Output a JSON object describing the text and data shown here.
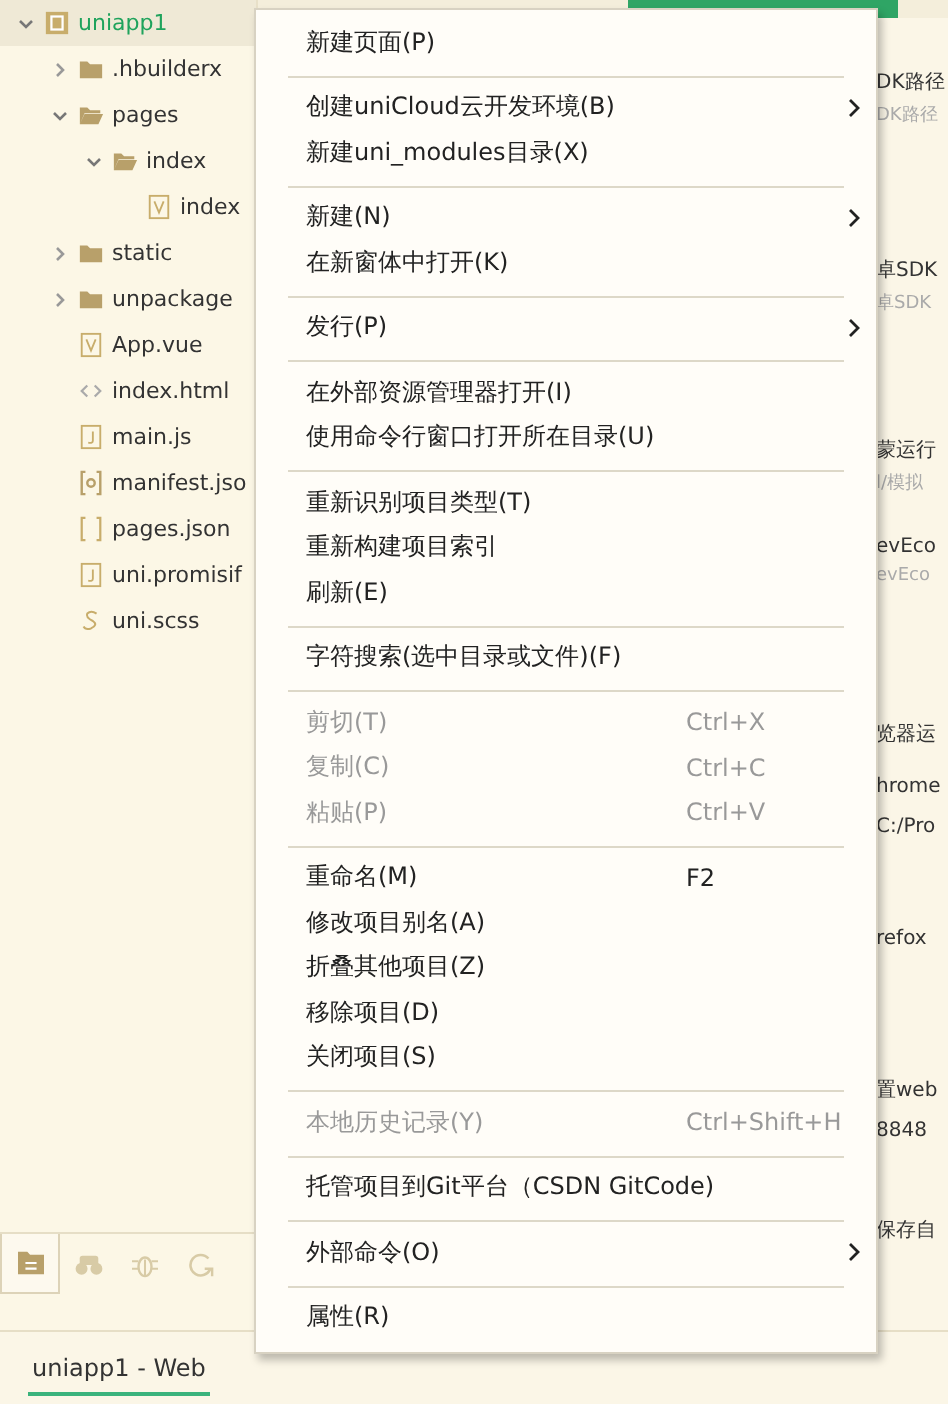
{
  "tree": [
    {
      "name": "uniapp1",
      "kind": "project",
      "expanded": true,
      "selected": true,
      "children": [
        {
          "name": ".hbuilderx",
          "kind": "folder",
          "expanded": false,
          "selected": false
        },
        {
          "name": "pages",
          "kind": "folder",
          "expanded": true,
          "selected": false,
          "children": [
            {
              "name": "index",
              "kind": "folder",
              "expanded": true,
              "selected": false,
              "children": [
                {
                  "name": "index",
                  "kind": "vue",
                  "selected": false
                }
              ]
            }
          ]
        },
        {
          "name": "static",
          "kind": "folder",
          "expanded": false,
          "selected": false
        },
        {
          "name": "unpackage",
          "kind": "folder",
          "expanded": false,
          "selected": false
        },
        {
          "name": "App.vue",
          "kind": "vue",
          "selected": false
        },
        {
          "name": "index.html",
          "kind": "html",
          "selected": false
        },
        {
          "name": "main.js",
          "kind": "js",
          "selected": false
        },
        {
          "name": "manifest.jso",
          "kind": "manifest",
          "selected": false
        },
        {
          "name": "pages.json",
          "kind": "json",
          "selected": false
        },
        {
          "name": "uni.promisif",
          "kind": "js",
          "selected": false
        },
        {
          "name": "uni.scss",
          "kind": "scss",
          "selected": false
        }
      ]
    }
  ],
  "sidebar_tabs": [
    {
      "selected": true
    },
    {
      "selected": false
    },
    {
      "selected": false
    },
    {
      "selected": false
    }
  ],
  "status_bar": {
    "label": "uniapp1 - Web"
  },
  "settings_fragments": [
    {
      "text": "DK路径",
      "muted": false
    },
    {
      "text": "DK路径",
      "muted": true
    },
    {
      "text": "卓SDK",
      "muted": false
    },
    {
      "text": "卓SDK",
      "muted": true
    },
    {
      "text": "蒙运行",
      "muted": false
    },
    {
      "text": "l/模拟",
      "muted": true
    },
    {
      "text": "evEco",
      "muted": false
    },
    {
      "text": "evEco",
      "muted": true
    },
    {
      "text": "览器运",
      "muted": false
    },
    {
      "text": "hrome",
      "muted": false
    },
    {
      "text": "C:/Pro",
      "muted": false
    },
    {
      "text": "refox",
      "muted": false
    },
    {
      "text": "置web",
      "muted": false
    },
    {
      "text": "8848",
      "muted": false
    },
    {
      "text": "保存自",
      "muted": false
    }
  ],
  "context_menu": [
    [
      {
        "label": "新建页面(P)",
        "disabled": false,
        "submenu": false
      }
    ],
    [
      {
        "label": "创建uniCloud云开发环境(B)",
        "disabled": false,
        "submenu": true
      },
      {
        "label": "新建uni_modules目录(X)",
        "disabled": false,
        "submenu": false
      }
    ],
    [
      {
        "label": "新建(N)",
        "disabled": false,
        "submenu": true
      },
      {
        "label": "在新窗体中打开(K)",
        "disabled": false,
        "submenu": false
      }
    ],
    [
      {
        "label": "发行(P)",
        "disabled": false,
        "submenu": true
      }
    ],
    [
      {
        "label": "在外部资源管理器打开(I)",
        "disabled": false,
        "submenu": false
      },
      {
        "label": "使用命令行窗口打开所在目录(U)",
        "disabled": false,
        "submenu": false
      }
    ],
    [
      {
        "label": "重新识别项目类型(T)",
        "disabled": false,
        "submenu": false
      },
      {
        "label": "重新构建项目索引",
        "disabled": false,
        "submenu": false
      },
      {
        "label": "刷新(E)",
        "disabled": false,
        "submenu": false
      }
    ],
    [
      {
        "label": "字符搜索(选中目录或文件)(F)",
        "disabled": false,
        "submenu": false
      }
    ],
    [
      {
        "label": "剪切(T)",
        "shortcut": "Ctrl+X",
        "disabled": true,
        "submenu": false
      },
      {
        "label": "复制(C)",
        "shortcut": "Ctrl+C",
        "disabled": true,
        "submenu": false
      },
      {
        "label": "粘贴(P)",
        "shortcut": "Ctrl+V",
        "disabled": true,
        "submenu": false
      }
    ],
    [
      {
        "label": "重命名(M)",
        "shortcut": "F2",
        "disabled": false,
        "submenu": false
      },
      {
        "label": "修改项目别名(A)",
        "disabled": false,
        "submenu": false
      },
      {
        "label": "折叠其他项目(Z)",
        "disabled": false,
        "submenu": false
      },
      {
        "label": "移除项目(D)",
        "disabled": false,
        "submenu": false
      },
      {
        "label": "关闭项目(S)",
        "disabled": false,
        "submenu": false
      }
    ],
    [
      {
        "label": "本地历史记录(Y)",
        "shortcut": "Ctrl+Shift+H",
        "disabled": true,
        "submenu": false
      }
    ],
    [
      {
        "label": "托管项目到Git平台（CSDN GitCode)",
        "disabled": false,
        "submenu": false
      }
    ],
    [
      {
        "label": "外部命令(O)",
        "disabled": false,
        "submenu": true
      }
    ],
    [
      {
        "label": "属性(R)",
        "disabled": false,
        "submenu": false
      }
    ]
  ]
}
